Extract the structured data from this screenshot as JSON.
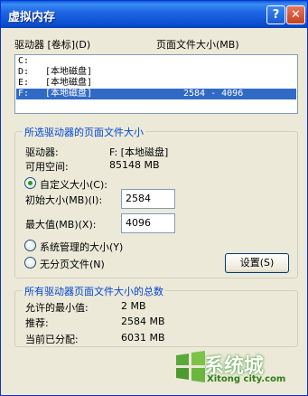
{
  "window": {
    "title": "虚拟内存",
    "help_label": "?",
    "close_label": "✕"
  },
  "drives": {
    "header_drive": "驱动器 [卷标](D)",
    "header_size": "页面文件大小(MB)",
    "rows": [
      {
        "drive": "C:",
        "label": "",
        "size": "",
        "selected": false
      },
      {
        "drive": "D:",
        "label": "[本地磁盘]",
        "size": "",
        "selected": false
      },
      {
        "drive": "E:",
        "label": "[本地磁盘]",
        "size": "",
        "selected": false
      },
      {
        "drive": "F:",
        "label": "[本地磁盘]",
        "size": "2584 - 4096",
        "selected": true
      }
    ]
  },
  "selected_drive": {
    "group_title": "所选驱动器的页面文件大小",
    "drive_label": "驱动器:",
    "drive_value": "F:  [本地磁盘]",
    "space_label": "可用空间:",
    "space_value": "85148 MB",
    "custom_label": "自定义大小(C):",
    "initial_label": "初始大小(MB)(I):",
    "initial_value": "2584",
    "max_label": "最大值(MB)(X):",
    "max_value": "4096",
    "system_label": "系统管理的大小(Y)",
    "none_label": "无分页文件(N)",
    "set_button": "设置(S)"
  },
  "totals": {
    "group_title": "所有驱动器页面文件大小的总数",
    "min_label": "允许的最小值:",
    "min_value": "2 MB",
    "rec_label": "推荐:",
    "rec_value": "2584 MB",
    "cur_label": "当前已分配:",
    "cur_value": "6031 MB"
  },
  "watermark": {
    "text": "系统城",
    "sub": "Xitong city.com"
  }
}
